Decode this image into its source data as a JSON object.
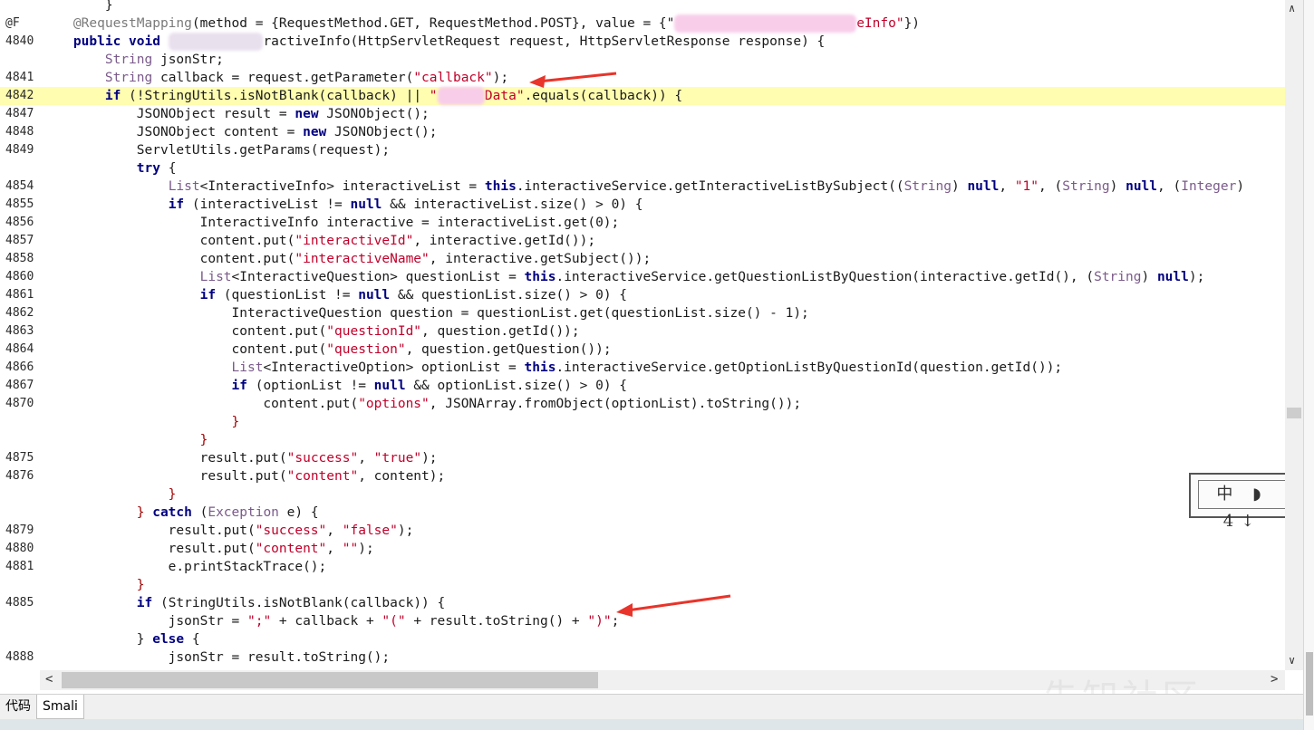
{
  "tabs": {
    "code_label": "代码",
    "smali_label": "Smali"
  },
  "stamp": {
    "text": "中 ◗ 4↓"
  },
  "watermark": "先知社区",
  "lines": [
    {
      "no": "",
      "code": [
        {
          "t": "        }",
          "c": ""
        }
      ]
    },
    {
      "no": "@F",
      "code": [
        {
          "t": "    ",
          "c": ""
        },
        {
          "t": "@RequestMapping",
          "c": "ann"
        },
        {
          "t": "(method = {RequestMethod.GET, RequestMethod.POST}, value = {\"",
          "c": ""
        },
        {
          "t": "xxxxxxxxxxxxxxxxxxxxxxx",
          "c": "blurpink"
        },
        {
          "t": "eInfo\"",
          "c": "str"
        },
        {
          "t": "})",
          "c": ""
        }
      ]
    },
    {
      "no": "4840",
      "code": [
        {
          "t": "    ",
          "c": ""
        },
        {
          "t": "public void",
          "c": "kw"
        },
        {
          "t": " ",
          "c": ""
        },
        {
          "t": "xxxxxxxxxxxx",
          "c": "blur"
        },
        {
          "t": "ractiveInfo(HttpServletRequest request, HttpServletResponse response) {",
          "c": ""
        }
      ]
    },
    {
      "no": "",
      "code": [
        {
          "t": "        ",
          "c": ""
        },
        {
          "t": "String",
          "c": "ty"
        },
        {
          "t": " jsonStr;",
          "c": ""
        }
      ]
    },
    {
      "no": "4841",
      "code": [
        {
          "t": "        ",
          "c": ""
        },
        {
          "t": "String",
          "c": "ty"
        },
        {
          "t": " callback = request.getParameter(",
          "c": ""
        },
        {
          "t": "\"callback\"",
          "c": "str"
        },
        {
          "t": ");",
          "c": ""
        }
      ]
    },
    {
      "no": "4842",
      "hl": true,
      "code": [
        {
          "t": "        ",
          "c": ""
        },
        {
          "t": "if",
          "c": "kw"
        },
        {
          "t": " (!StringUtils.isNotBlank(callback) || ",
          "c": ""
        },
        {
          "t": "\"",
          "c": "str"
        },
        {
          "t": "xxxxxx",
          "c": "blurpink"
        },
        {
          "t": "Data\"",
          "c": "str"
        },
        {
          "t": ".equals(callback)) {",
          "c": ""
        }
      ]
    },
    {
      "no": "4847",
      "code": [
        {
          "t": "            JSONObject result = ",
          "c": ""
        },
        {
          "t": "new",
          "c": "kw"
        },
        {
          "t": " JSONObject();",
          "c": ""
        }
      ]
    },
    {
      "no": "4848",
      "code": [
        {
          "t": "            JSONObject content = ",
          "c": ""
        },
        {
          "t": "new",
          "c": "kw"
        },
        {
          "t": " JSONObject();",
          "c": ""
        }
      ]
    },
    {
      "no": "4849",
      "code": [
        {
          "t": "            ServletUtils.getParams(request);",
          "c": ""
        }
      ]
    },
    {
      "no": "",
      "code": [
        {
          "t": "            ",
          "c": ""
        },
        {
          "t": "try",
          "c": "kw"
        },
        {
          "t": " {",
          "c": ""
        }
      ]
    },
    {
      "no": "4854",
      "code": [
        {
          "t": "                ",
          "c": ""
        },
        {
          "t": "List",
          "c": "ty"
        },
        {
          "t": "<InteractiveInfo> interactiveList = ",
          "c": ""
        },
        {
          "t": "this",
          "c": "kw"
        },
        {
          "t": ".interactiveService.getInteractiveListBySubject((",
          "c": ""
        },
        {
          "t": "String",
          "c": "ty"
        },
        {
          "t": ") ",
          "c": ""
        },
        {
          "t": "null",
          "c": "kw"
        },
        {
          "t": ", ",
          "c": ""
        },
        {
          "t": "\"1\"",
          "c": "str"
        },
        {
          "t": ", (",
          "c": ""
        },
        {
          "t": "String",
          "c": "ty"
        },
        {
          "t": ") ",
          "c": ""
        },
        {
          "t": "null",
          "c": "kw"
        },
        {
          "t": ", (",
          "c": ""
        },
        {
          "t": "Integer",
          "c": "ty"
        },
        {
          "t": ")",
          "c": ""
        }
      ]
    },
    {
      "no": "4855",
      "code": [
        {
          "t": "                ",
          "c": ""
        },
        {
          "t": "if",
          "c": "kw"
        },
        {
          "t": " (interactiveList != ",
          "c": ""
        },
        {
          "t": "null",
          "c": "kw"
        },
        {
          "t": " && interactiveList.size() > 0) {",
          "c": ""
        }
      ]
    },
    {
      "no": "4856",
      "code": [
        {
          "t": "                    InteractiveInfo interactive = interactiveList.get(0);",
          "c": ""
        }
      ]
    },
    {
      "no": "4857",
      "code": [
        {
          "t": "                    content.put(",
          "c": ""
        },
        {
          "t": "\"interactiveId\"",
          "c": "str"
        },
        {
          "t": ", interactive.getId());",
          "c": ""
        }
      ]
    },
    {
      "no": "4858",
      "code": [
        {
          "t": "                    content.put(",
          "c": ""
        },
        {
          "t": "\"interactiveName\"",
          "c": "str"
        },
        {
          "t": ", interactive.getSubject());",
          "c": ""
        }
      ]
    },
    {
      "no": "4860",
      "code": [
        {
          "t": "                    ",
          "c": ""
        },
        {
          "t": "List",
          "c": "ty"
        },
        {
          "t": "<InteractiveQuestion> questionList = ",
          "c": ""
        },
        {
          "t": "this",
          "c": "kw"
        },
        {
          "t": ".interactiveService.getQuestionListByQuestion(interactive.getId(), (",
          "c": ""
        },
        {
          "t": "String",
          "c": "ty"
        },
        {
          "t": ") ",
          "c": ""
        },
        {
          "t": "null",
          "c": "kw"
        },
        {
          "t": ");",
          "c": ""
        }
      ]
    },
    {
      "no": "4861",
      "code": [
        {
          "t": "                    ",
          "c": ""
        },
        {
          "t": "if",
          "c": "kw"
        },
        {
          "t": " (questionList != ",
          "c": ""
        },
        {
          "t": "null",
          "c": "kw"
        },
        {
          "t": " && questionList.size() > 0) {",
          "c": ""
        }
      ]
    },
    {
      "no": "4862",
      "code": [
        {
          "t": "                        InteractiveQuestion question = questionList.get(questionList.size() - 1);",
          "c": ""
        }
      ]
    },
    {
      "no": "4863",
      "code": [
        {
          "t": "                        content.put(",
          "c": ""
        },
        {
          "t": "\"questionId\"",
          "c": "str"
        },
        {
          "t": ", question.getId());",
          "c": ""
        }
      ]
    },
    {
      "no": "4864",
      "code": [
        {
          "t": "                        content.put(",
          "c": ""
        },
        {
          "t": "\"question\"",
          "c": "str"
        },
        {
          "t": ", question.getQuestion());",
          "c": ""
        }
      ]
    },
    {
      "no": "4866",
      "code": [
        {
          "t": "                        ",
          "c": ""
        },
        {
          "t": "List",
          "c": "ty"
        },
        {
          "t": "<InteractiveOption> optionList = ",
          "c": ""
        },
        {
          "t": "this",
          "c": "kw"
        },
        {
          "t": ".interactiveService.getOptionListByQuestionId(question.getId());",
          "c": ""
        }
      ]
    },
    {
      "no": "4867",
      "code": [
        {
          "t": "                        ",
          "c": ""
        },
        {
          "t": "if",
          "c": "kw"
        },
        {
          "t": " (optionList != ",
          "c": ""
        },
        {
          "t": "null",
          "c": "kw"
        },
        {
          "t": " && optionList.size() > 0) {",
          "c": ""
        }
      ]
    },
    {
      "no": "4870",
      "code": [
        {
          "t": "                            content.put(",
          "c": ""
        },
        {
          "t": "\"options\"",
          "c": "str"
        },
        {
          "t": ", JSONArray.fromObject(optionList).toString());",
          "c": ""
        }
      ]
    },
    {
      "no": "",
      "code": [
        {
          "t": "                        }",
          "c": "red"
        }
      ]
    },
    {
      "no": "",
      "code": [
        {
          "t": "                    }",
          "c": "red"
        }
      ]
    },
    {
      "no": "4875",
      "code": [
        {
          "t": "                    result.put(",
          "c": ""
        },
        {
          "t": "\"success\"",
          "c": "str"
        },
        {
          "t": ", ",
          "c": ""
        },
        {
          "t": "\"true\"",
          "c": "str"
        },
        {
          "t": ");",
          "c": ""
        }
      ]
    },
    {
      "no": "4876",
      "code": [
        {
          "t": "                    result.put(",
          "c": ""
        },
        {
          "t": "\"content\"",
          "c": "str"
        },
        {
          "t": ", content);",
          "c": ""
        }
      ]
    },
    {
      "no": "",
      "code": [
        {
          "t": "                }",
          "c": "red"
        }
      ]
    },
    {
      "no": "",
      "code": [
        {
          "t": "            } ",
          "c": "red"
        },
        {
          "t": "catch",
          "c": "kw"
        },
        {
          "t": " (",
          "c": ""
        },
        {
          "t": "Exception",
          "c": "ty"
        },
        {
          "t": " e) {",
          "c": ""
        }
      ]
    },
    {
      "no": "4879",
      "code": [
        {
          "t": "                result.put(",
          "c": ""
        },
        {
          "t": "\"success\"",
          "c": "str"
        },
        {
          "t": ", ",
          "c": ""
        },
        {
          "t": "\"false\"",
          "c": "str"
        },
        {
          "t": ");",
          "c": ""
        }
      ]
    },
    {
      "no": "4880",
      "code": [
        {
          "t": "                result.put(",
          "c": ""
        },
        {
          "t": "\"content\"",
          "c": "str"
        },
        {
          "t": ", ",
          "c": ""
        },
        {
          "t": "\"\"",
          "c": "str"
        },
        {
          "t": ");",
          "c": ""
        }
      ]
    },
    {
      "no": "4881",
      "code": [
        {
          "t": "                e.printStackTrace();",
          "c": ""
        }
      ]
    },
    {
      "no": "",
      "code": [
        {
          "t": "            }",
          "c": "red"
        }
      ]
    },
    {
      "no": "4885",
      "code": [
        {
          "t": "            ",
          "c": ""
        },
        {
          "t": "if",
          "c": "kw"
        },
        {
          "t": " (StringUtils.isNotBlank(callback)) {",
          "c": ""
        }
      ]
    },
    {
      "no": "",
      "code": [
        {
          "t": "                jsonStr = ",
          "c": ""
        },
        {
          "t": "\";\"",
          "c": "str"
        },
        {
          "t": " + callback + ",
          "c": ""
        },
        {
          "t": "\"(\"",
          "c": "str"
        },
        {
          "t": " + result.toString() + ",
          "c": ""
        },
        {
          "t": "\")\"",
          "c": "str"
        },
        {
          "t": ";",
          "c": ""
        }
      ]
    },
    {
      "no": "",
      "code": [
        {
          "t": "            } ",
          "c": ""
        },
        {
          "t": "else",
          "c": "kw"
        },
        {
          "t": " {",
          "c": ""
        }
      ]
    },
    {
      "no": "4888",
      "code": [
        {
          "t": "                jsonStr = result.toString();",
          "c": ""
        }
      ]
    }
  ]
}
